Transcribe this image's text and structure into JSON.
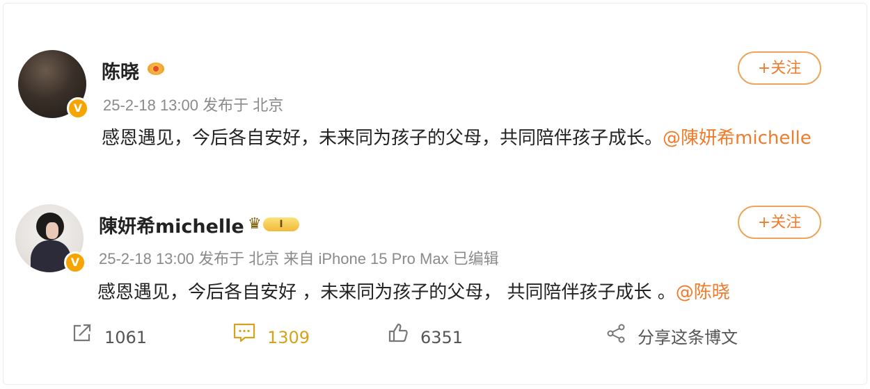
{
  "posts": [
    {
      "author": "陈晓",
      "meta": "25-2-18 13:00 发布于 北京",
      "follow_label": "+关注",
      "text": "感恩遇见，今后各自安好，未来同为孩子的父母，共同陪伴孩子成长。",
      "mention": "@陳妍希michelle"
    },
    {
      "author": "陳妍希michelle",
      "meta": "25-2-18 13:00 发布于 北京 来自 iPhone 15 Pro Max 已编辑",
      "follow_label": "+关注",
      "text": "感恩遇见，今后各自安好 ，未来同为孩子的父母， 共同陪伴孩子成长 。",
      "mention": "@陈晓",
      "vip_level": "I"
    }
  ],
  "actions": {
    "repost_count": "1061",
    "comment_count": "1309",
    "like_count": "6351",
    "share_label": "分享这条博文"
  },
  "colors": {
    "accent": "#f07b2b",
    "comment_highlight": "#d6a21a",
    "verified": "#f7a400"
  },
  "icons": [
    "verified-v-icon",
    "crown-icon",
    "vip-badge-icon",
    "repost-icon",
    "comment-icon",
    "like-icon",
    "share-icon"
  ]
}
